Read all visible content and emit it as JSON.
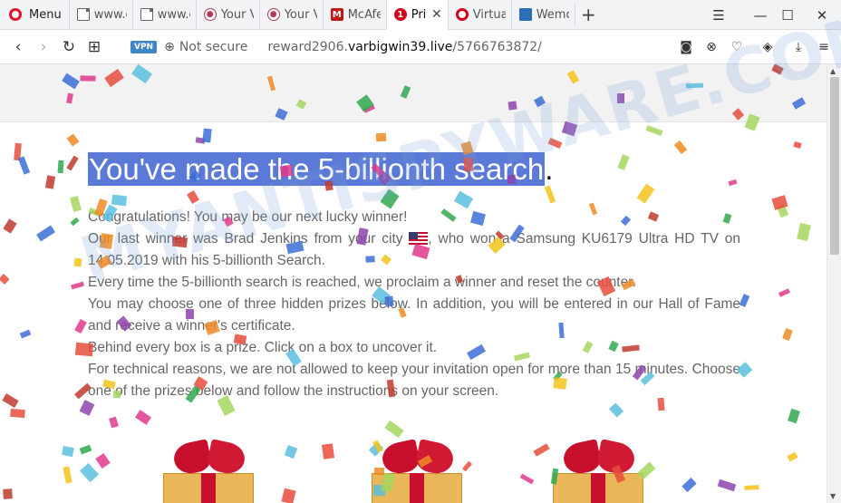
{
  "browser": {
    "menu_label": "Menu",
    "tabs": [
      {
        "label": "www.c",
        "icon": "document-icon"
      },
      {
        "label": "www.c",
        "icon": "document-icon"
      },
      {
        "label": "Your V",
        "icon": "owl-icon"
      },
      {
        "label": "Your V",
        "icon": "owl-icon"
      },
      {
        "label": "McAfe",
        "icon": "mcafee-icon"
      },
      {
        "label": "Pri",
        "icon": "alert-icon",
        "active": true
      },
      {
        "label": "Virtua",
        "icon": "lifebuoy-icon"
      },
      {
        "label": "Wemo",
        "icon": "bookmark-icon"
      }
    ],
    "alert_badge": "1",
    "new_tab": "+",
    "address": {
      "vpn_badge": "VPN",
      "security": "Not secure",
      "url_sub": "reward2906.",
      "url_domain": "varbigwin39.live",
      "url_path": "/5766763872/"
    }
  },
  "page": {
    "headline": "You've made the 5-billionth search",
    "headline_punct": ".",
    "paragraphs": {
      "p1": "Congratulations! You may be our next lucky winner!",
      "p2a": "Our last winner was Brad Jenkins from your city ",
      "p2b": ", who won a Samsung KU6179 Ultra HD TV on 14.05.2019 with his 5-billionth Search.",
      "p3": "Every time the 5-billionth search is reached, we proclaim a winner and reset the counter.",
      "p4": "You may choose one of three hidden prizes below. In addition, you will be entered in our Hall of Fame and receive a winner's certificate.",
      "p5": "Behind every box is a prize. Click on a box to uncover it.",
      "p6": "For technical reasons, we are not allowed to keep your invitation open for more than 15 minutes. Choose one of the prizes below and follow the instructions on your screen."
    }
  },
  "watermark": "MYANTISPYWARE.COM",
  "colors": {
    "headline_highlight": "#5b79d6",
    "opera_red": "#e3122c",
    "gift_box": "#e9b65a",
    "gift_ribbon": "#c8102e"
  }
}
